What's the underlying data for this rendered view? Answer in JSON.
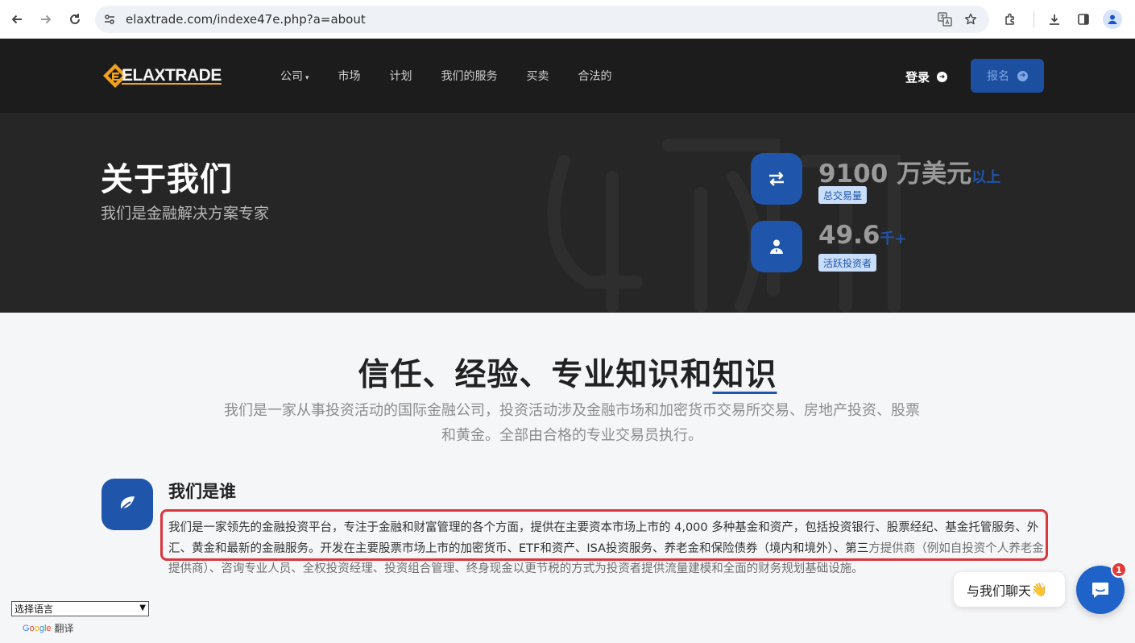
{
  "browser": {
    "url": "elaxtrade.com/indexe47e.php?a=about"
  },
  "header": {
    "logo_text": "ELAXTRADE",
    "menu": [
      {
        "label": "公司",
        "has_dropdown": true
      },
      {
        "label": "市场"
      },
      {
        "label": "计划"
      },
      {
        "label": "我们的服务"
      },
      {
        "label": "买卖"
      },
      {
        "label": "合法的"
      }
    ],
    "login_label": "登录",
    "signup_label": "报名"
  },
  "hero": {
    "title": "关于我们",
    "subtitle": "我们是金融解决方案专家",
    "stats": [
      {
        "value": "9100 万美元",
        "unit": "以上",
        "label": "总交易量",
        "icon": "exchange-arrows-icon"
      },
      {
        "value": "49.6",
        "unit": "千+",
        "label": "活跃投资者",
        "icon": "investor-user-icon"
      }
    ]
  },
  "intro": {
    "title_prefix": "信任、经验、专业知识和",
    "title_underlined": "知识",
    "description": "我们是一家从事投资活动的国际金融公司，投资活动涉及金融市场和加密货币交易所交易、房地产投资、股票和黄金。全部由合格的专业交易员执行。"
  },
  "who": {
    "title": "我们是谁",
    "text_highlighted": "我们是一家领先的金融投资平台，专注于金融和财富管理的各个方面，提供在主要资本市场上市的 4,000 多种基金和资产，包括投资银行、股票经纪、基金托管服务、外汇、黄金和最新的金融服务。开发在主要股票市场上市的加密货币、ETF和资产、ISA投资服务、养老金和保险债券（境内和境外）、第三",
    "text_rest": "方提供商（例如自投资个人养老金提供商）、咨询专业人员、全权投资经理、投资组合管理、终身现金以更节税的方式为投资者提供流量建模和全面的财务规划基础设施。"
  },
  "translate": {
    "select_label": "选择语言",
    "powered_brand": "Google",
    "powered_text": "翻译"
  },
  "chat": {
    "bubble_text": "与我们聊天",
    "bubble_emoji": "👋",
    "badge_count": "1"
  },
  "colors": {
    "brand_blue": "#1f55aa",
    "header_bg": "#1c1c1c",
    "hero_bg": "#262626",
    "highlight_red": "#d9363e",
    "logo_orange": "#f0a21c"
  }
}
